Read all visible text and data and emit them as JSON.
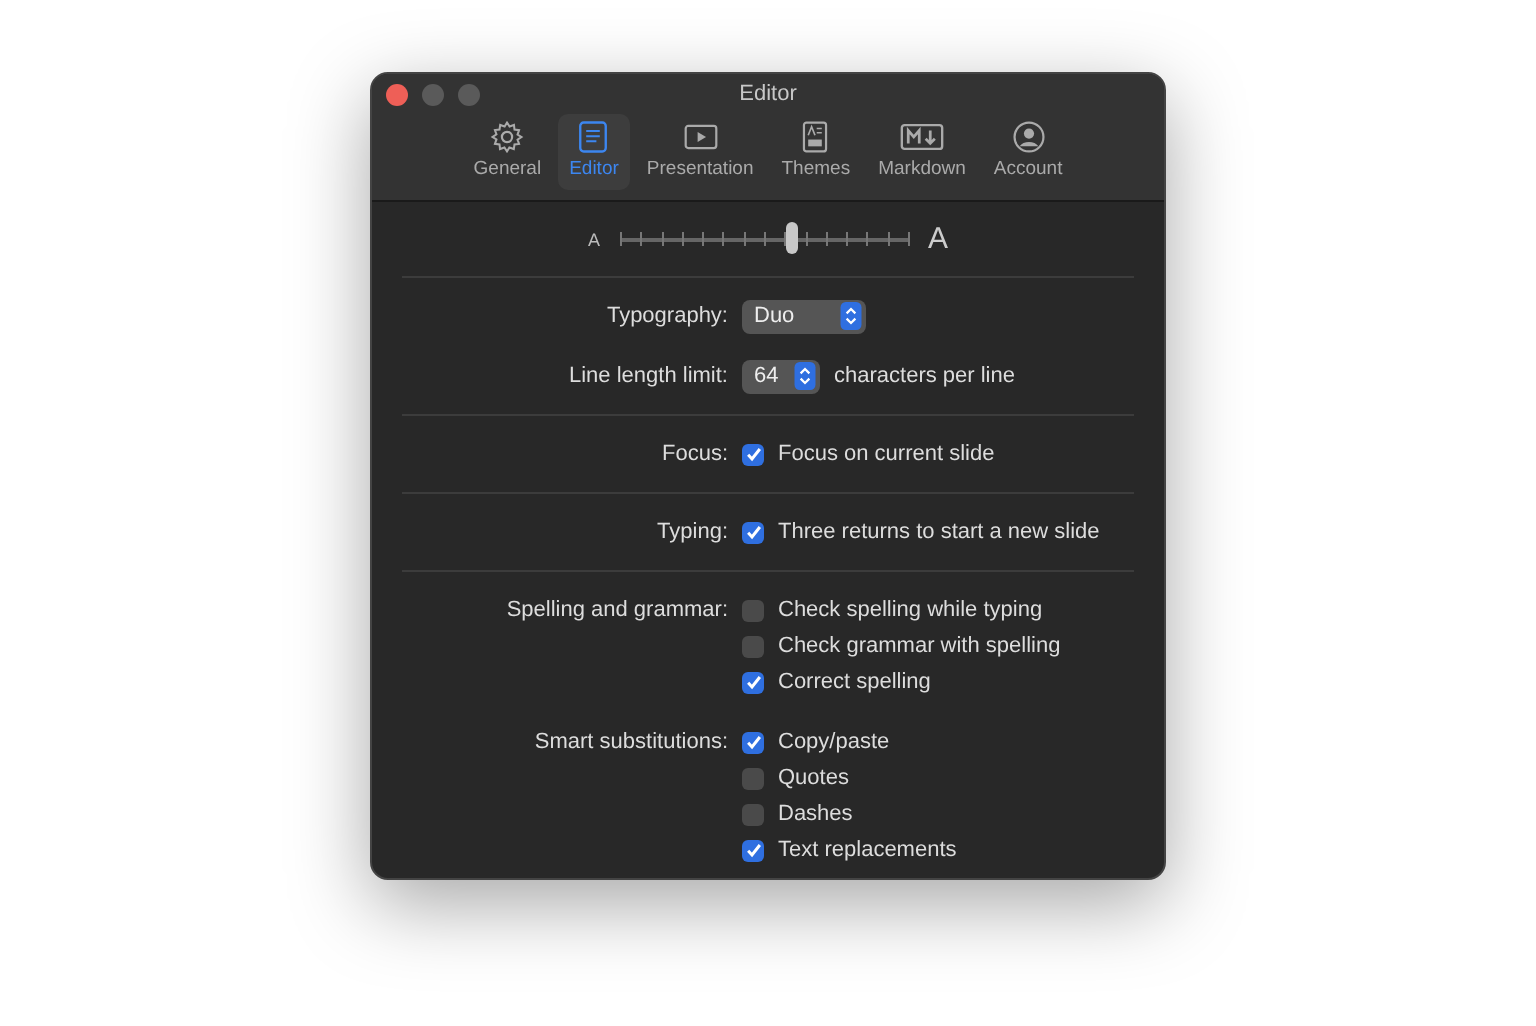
{
  "window": {
    "title": "Editor"
  },
  "tabs": [
    {
      "label": "General",
      "kind": "gear",
      "selected": false
    },
    {
      "label": "Editor",
      "kind": "editor",
      "selected": true
    },
    {
      "label": "Presentation",
      "kind": "play",
      "selected": false
    },
    {
      "label": "Themes",
      "kind": "themes",
      "selected": false
    },
    {
      "label": "Markdown",
      "kind": "markdown",
      "selected": false
    },
    {
      "label": "Account",
      "kind": "account",
      "selected": false
    }
  ],
  "font_size_slider": {
    "small_label": "A",
    "large_label": "A",
    "level": 0.6
  },
  "sections": [
    {
      "groups": [
        {
          "label": "Typography:",
          "kind": "popup",
          "value": "Duo"
        },
        {
          "label": "Line length limit:",
          "kind": "stepper",
          "value": "64",
          "suffix": "characters per line"
        }
      ]
    },
    {
      "groups": [
        {
          "label": "Focus:",
          "kind": "checks",
          "options": [
            {
              "label": "Focus on current slide",
              "checked": true
            }
          ]
        }
      ]
    },
    {
      "groups": [
        {
          "label": "Typing:",
          "kind": "checks",
          "options": [
            {
              "label": "Three returns to start a new slide",
              "checked": true
            }
          ]
        }
      ]
    },
    {
      "groups": [
        {
          "label": "Spelling and grammar:",
          "kind": "checks",
          "options": [
            {
              "label": "Check spelling while typing",
              "checked": false
            },
            {
              "label": "Check grammar with spelling",
              "checked": false
            },
            {
              "label": "Correct spelling",
              "checked": true
            }
          ]
        },
        {
          "label": "Smart substitutions:",
          "kind": "checks",
          "options": [
            {
              "label": "Copy/paste",
              "checked": true
            },
            {
              "label": "Quotes",
              "checked": false
            },
            {
              "label": "Dashes",
              "checked": false
            },
            {
              "label": "Text replacements",
              "checked": true
            }
          ]
        }
      ]
    }
  ]
}
